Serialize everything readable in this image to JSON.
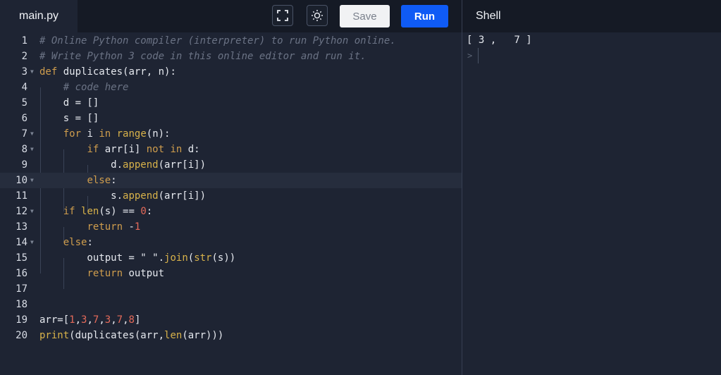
{
  "header": {
    "file_tab": "main.py",
    "save_label": "Save",
    "run_label": "Run",
    "shell_tab": "Shell",
    "fullscreen_icon": "fullscreen-icon",
    "theme_icon": "sun-icon"
  },
  "editor": {
    "line_numbers": [
      "1",
      "2",
      "3",
      "4",
      "5",
      "6",
      "7",
      "8",
      "9",
      "10",
      "11",
      "12",
      "13",
      "14",
      "15",
      "16",
      "17",
      "18",
      "19",
      "20"
    ],
    "lines": [
      "# Online Python compiler (interpreter) to run Python online.",
      "# Write Python 3 code in this online editor and run it.",
      "def duplicates(arr, n):",
      "    # code here",
      "    d = []",
      "    s = []",
      "    for i in range(n):",
      "        if arr[i] not in d:",
      "            d.append(arr[i])",
      "        else:",
      "            s.append(arr[i])",
      "    if len(s) == 0:",
      "        return -1",
      "    else:",
      "        output = \" \".join(str(s))",
      "        return output",
      "",
      "",
      "arr=[1,3,7,3,7,8]",
      "print(duplicates(arr,len(arr)))"
    ],
    "active_line": "10"
  },
  "shell": {
    "output": "[ 3 ,   7 ]",
    "prompt": ">"
  },
  "colors": {
    "background": "#1e2433",
    "run_button": "#0f5bf5",
    "keyword": "#cf9d4d",
    "number": "#e56a5a",
    "comment": "#6b7385"
  }
}
